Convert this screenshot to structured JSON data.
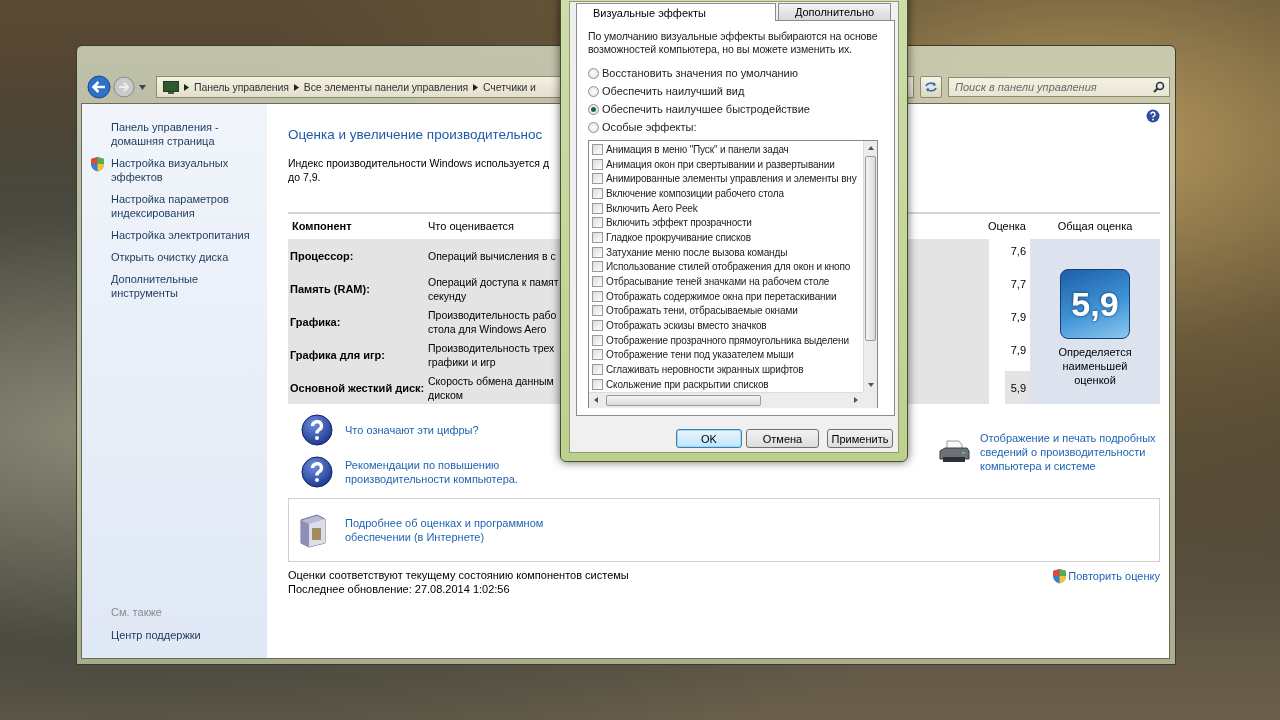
{
  "control_panel": {
    "breadcrumb": [
      "Панель управления",
      "Все элементы панели управления",
      "Счетчики и"
    ],
    "search": {
      "placeholder": "Поиск в панели управления"
    },
    "sidebar": {
      "items": [
        {
          "label": "Панель управления - домашняя страница",
          "kind": "plain"
        },
        {
          "label": "Настройка визуальных эффектов",
          "kind": "shield"
        },
        {
          "label": "Настройка параметров индексирования",
          "kind": "plain"
        },
        {
          "label": "Настройка электропитания",
          "kind": "plain"
        },
        {
          "label": "Открыть очистку диска",
          "kind": "plain"
        },
        {
          "label": "Дополнительные инструменты",
          "kind": "plain"
        }
      ],
      "see_also_heading": "См. также",
      "see_also": [
        "Центр поддержки"
      ]
    },
    "heading": "Оценка и увеличение производительнос",
    "description_lines": [
      "Индекс производительности Windows используется д",
      "до 7,9."
    ],
    "table": {
      "columns": [
        "Компонент",
        "Что оценивается",
        "Оценка",
        "Общая оценка"
      ],
      "rows": [
        {
          "component": "Процессор:",
          "measures": [
            "Операций вычисления в с"
          ],
          "score": "7,6",
          "lowest": false
        },
        {
          "component": "Память (RAM):",
          "measures": [
            "Операций доступа к памят",
            "секунду"
          ],
          "score": "7,7",
          "lowest": false
        },
        {
          "component": "Графика:",
          "measures": [
            "Производительность рабо",
            "стола для Windows Aero"
          ],
          "score": "7,9",
          "lowest": false
        },
        {
          "component": "Графика для игр:",
          "measures": [
            "Производительность трех",
            "графики и игр"
          ],
          "score": "7,9",
          "lowest": false
        },
        {
          "component": "Основной жесткий диск:",
          "measures": [
            "Скорость обмена данным",
            "диском"
          ],
          "score": "5,9",
          "lowest": true
        }
      ],
      "base_score": "5,9",
      "base_note": "Определяется наименьшей оценкой"
    },
    "help_links": [
      "Что означают эти цифры?",
      "Рекомендации по повышению производительности компьютера."
    ],
    "print_link": "Отображение и печать подробных сведений о производительности компьютера и системе",
    "online_link": "Подробнее об оценках и программном обеспечении (в Интернете)",
    "status": [
      "Оценки соответствуют текущему состоянию компонентов системы",
      "Последнее обновление: 27.08.2014 1:02:56"
    ],
    "rerun_link": "Повторить оценку"
  },
  "dialog": {
    "tabs": [
      {
        "label": "Визуальные эффекты",
        "selected": true
      },
      {
        "label": "Дополнительно",
        "selected": false
      }
    ],
    "description": "По умолчанию визуальные эффекты выбираются на основе возможностей компьютера, но вы можете изменить их.",
    "options": [
      {
        "label": "Восстановить значения по умолчанию",
        "selected": false
      },
      {
        "label": "Обеспечить наилучший вид",
        "selected": false
      },
      {
        "label": "Обеспечить наилучшее быстродействие",
        "selected": true
      },
      {
        "label": "Особые эффекты:",
        "selected": false
      }
    ],
    "effects": [
      {
        "label": "Анимация в меню \"Пуск\" и панели задач",
        "checked": false
      },
      {
        "label": "Анимация окон при свертывании и развертывании",
        "checked": false
      },
      {
        "label": "Анимированные элементы управления и элементы вну",
        "checked": false
      },
      {
        "label": "Включение композиции рабочего стола",
        "checked": false
      },
      {
        "label": "Включить Aero Peek",
        "checked": false
      },
      {
        "label": "Включить эффект прозрачности",
        "checked": false
      },
      {
        "label": "Гладкое прокручивание списков",
        "checked": false
      },
      {
        "label": "Затухание меню после вызова команды",
        "checked": false
      },
      {
        "label": "Использование стилей отображения для окон и кнопо",
        "checked": false
      },
      {
        "label": "Отбрасывание теней значками на рабочем столе",
        "checked": false
      },
      {
        "label": "Отображать содержимое окна при перетаскивании",
        "checked": false
      },
      {
        "label": "Отображать тени, отбрасываемые окнами",
        "checked": false
      },
      {
        "label": "Отображать эскизы вместо значков",
        "checked": false
      },
      {
        "label": "Отображение прозрачного прямоугольника выделени",
        "checked": false
      },
      {
        "label": "Отображение тени под указателем мыши",
        "checked": false
      },
      {
        "label": "Сглаживать неровности экранных шрифтов",
        "checked": false
      },
      {
        "label": "Скольжение при раскрытии списков",
        "checked": false
      }
    ],
    "buttons": [
      {
        "label": "OK",
        "default": true
      },
      {
        "label": "Отмена",
        "default": false
      },
      {
        "label": "Применить",
        "default": false
      }
    ]
  }
}
